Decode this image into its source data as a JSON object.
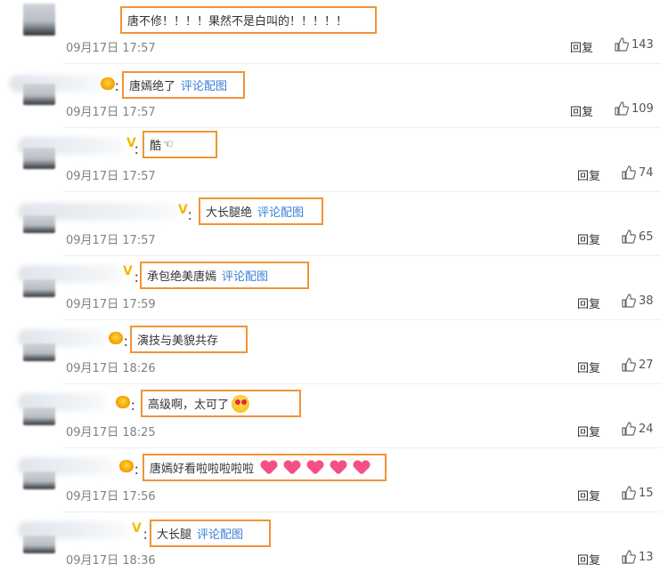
{
  "ui": {
    "reply_label": "回复",
    "link_label": "评论配图",
    "colon": "："
  },
  "comments": [
    {
      "text": "唐不修！！！！果然不是白叫的！！！！！",
      "time": "09月17日 17:57",
      "likes": "143",
      "has_link": false
    },
    {
      "text": "唐嫣绝了",
      "time": "09月17日 17:57",
      "likes": "109",
      "has_link": true
    },
    {
      "text": "酷",
      "time": "09月17日 17:57",
      "likes": "74",
      "has_link": false
    },
    {
      "text": "大长腿绝",
      "time": "09月17日 17:57",
      "likes": "65",
      "has_link": true
    },
    {
      "text": "承包绝美唐嫣",
      "time": "09月17日 17:59",
      "likes": "38",
      "has_link": true
    },
    {
      "text": "演技与美貌共存",
      "time": "09月17日 18:26",
      "likes": "27",
      "has_link": false
    },
    {
      "text": "高级啊，太可了",
      "time": "09月17日 18:25",
      "likes": "24",
      "has_link": false
    },
    {
      "text": "唐嫣好看啦啦啦啦啦",
      "time": "09月17日 17:56",
      "likes": "15",
      "has_link": false
    },
    {
      "text": "大长腿",
      "time": "09月17日 18:36",
      "likes": "13",
      "has_link": true
    }
  ],
  "icons": {
    "like": "thumbs-up-icon",
    "heart": "heart-emoji-icon",
    "face": "heart-eyes-emoji-icon",
    "hand": "pointing-hand-emoji-icon",
    "vip": "vip-badge-icon",
    "crown": "crown-badge-icon"
  },
  "colors": {
    "highlight_border": "#f19435",
    "link": "#3a7ed8",
    "time": "#808080",
    "vip": "#f6b800"
  }
}
